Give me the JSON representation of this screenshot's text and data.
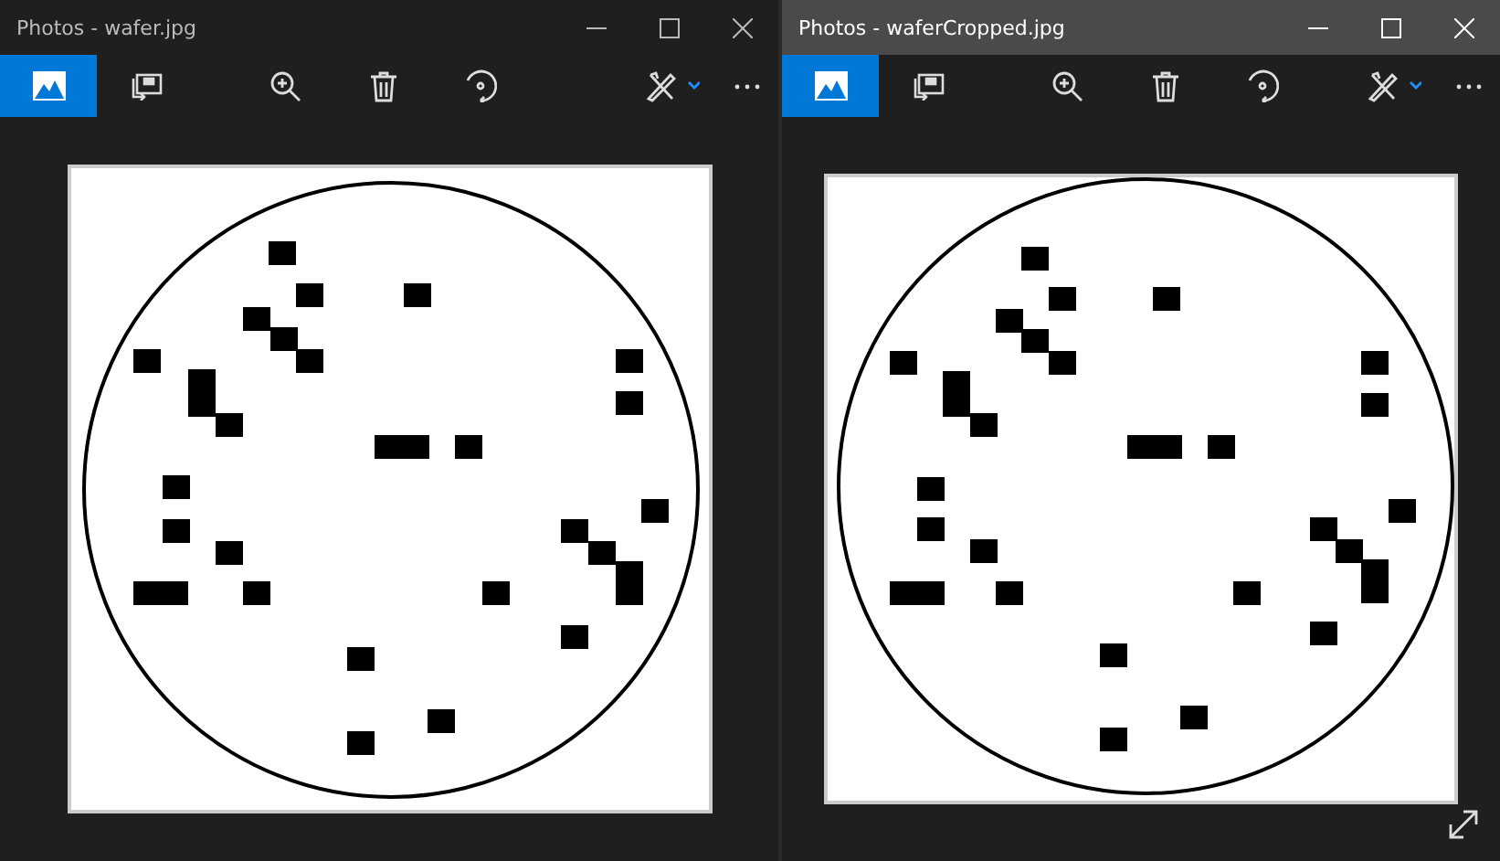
{
  "windows": [
    {
      "title": "Photos - wafer.jpg",
      "active": false,
      "expand_icon": false
    },
    {
      "title": "Photos - waferCropped.jpg",
      "active": true,
      "expand_icon": true
    }
  ]
}
